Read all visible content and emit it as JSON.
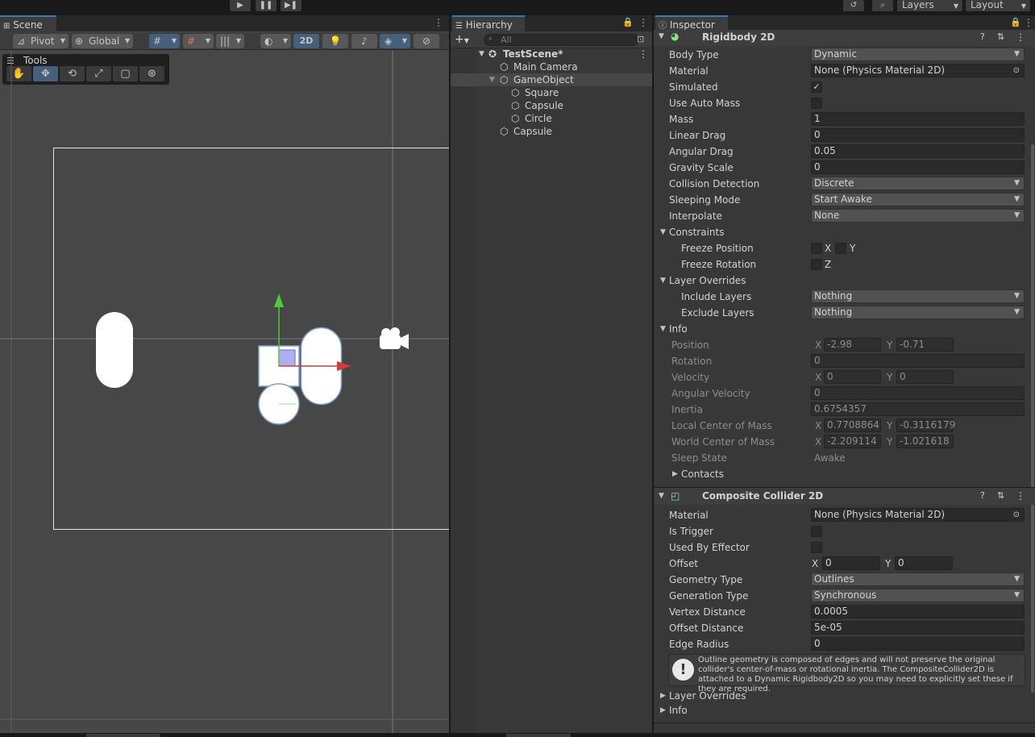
{
  "toolbar": {
    "play_icon": "play-icon",
    "pause_icon": "pause-icon",
    "step_icon": "step-icon",
    "history_icon": "history-icon",
    "search_icon": "search-icon",
    "layers_label": "Layers",
    "layout_label": "Layout"
  },
  "scene": {
    "tab_label": "Scene",
    "pivot_label": "Pivot",
    "global_label": "Global",
    "mode_2d_label": "2D",
    "tools_label": "Tools",
    "tools": [
      "hand-icon",
      "move-icon",
      "rotate-icon",
      "scale-icon",
      "rect-icon",
      "transform-icon"
    ]
  },
  "hierarchy": {
    "tab_label": "Hierarchy",
    "search_placeholder": "All",
    "items": [
      {
        "label": "TestScene*",
        "icon": "unity-scene-icon"
      },
      {
        "label": "Main Camera",
        "icon": "cube-icon"
      },
      {
        "label": "GameObject",
        "icon": "cube-icon",
        "selected": true
      },
      {
        "label": "Square",
        "icon": "cube-icon"
      },
      {
        "label": "Capsule",
        "icon": "cube-icon"
      },
      {
        "label": "Circle",
        "icon": "cube-icon"
      },
      {
        "label": "Capsule",
        "icon": "cube-icon"
      }
    ]
  },
  "inspector": {
    "tab_label": "Inspector",
    "rigidbody": {
      "title": "Rigidbody 2D",
      "body_type_label": "Body Type",
      "body_type": "Dynamic",
      "material_label": "Material",
      "material": "None (Physics Material 2D)",
      "simulated_label": "Simulated",
      "simulated_check": "✓",
      "use_auto_mass_label": "Use Auto Mass",
      "mass_label": "Mass",
      "mass": "1",
      "linear_drag_label": "Linear Drag",
      "linear_drag": "0",
      "angular_drag_label": "Angular Drag",
      "angular_drag": "0.05",
      "gravity_scale_label": "Gravity Scale",
      "gravity_scale": "0",
      "collision_detection_label": "Collision Detection",
      "collision_detection": "Discrete",
      "sleeping_mode_label": "Sleeping Mode",
      "sleeping_mode": "Start Awake",
      "interpolate_label": "Interpolate",
      "interpolate": "None",
      "constraints_label": "Constraints",
      "freeze_position_label": "Freeze Position",
      "freeze_x": "X",
      "freeze_y": "Y",
      "freeze_rotation_label": "Freeze Rotation",
      "freeze_z": "Z",
      "layer_overrides_label": "Layer Overrides",
      "include_layers_label": "Include Layers",
      "include_layers": "Nothing",
      "exclude_layers_label": "Exclude Layers",
      "exclude_layers": "Nothing",
      "info_label": "Info",
      "position_label": "Position",
      "x_label": "X",
      "y_label": "Y",
      "position_x": "-2.98",
      "position_y": "-0.71",
      "rotation_label": "Rotation",
      "rotation": "0",
      "velocity_label": "Velocity",
      "velocity_x": "0",
      "velocity_y": "0",
      "angular_velocity_label": "Angular Velocity",
      "angular_velocity": "0",
      "inertia_label": "Inertia",
      "inertia": "0.6754357",
      "local_com_label": "Local Center of Mass",
      "local_com_x": "0.7708864",
      "local_com_y": "-0.3116179",
      "world_com_label": "World Center of Mass",
      "world_com_x": "-2.209114",
      "world_com_y": "-1.021618",
      "sleep_state_label": "Sleep State",
      "sleep_state": "Awake",
      "contacts_label": "Contacts"
    },
    "composite": {
      "title": "Composite Collider 2D",
      "material_label": "Material",
      "material": "None (Physics Material 2D)",
      "is_trigger_label": "Is Trigger",
      "used_by_effector_label": "Used By Effector",
      "offset_label": "Offset",
      "x_label": "X",
      "y_label": "Y",
      "offset_x": "0",
      "offset_y": "0",
      "geometry_type_label": "Geometry Type",
      "geometry_type": "Outlines",
      "generation_type_label": "Generation Type",
      "generation_type": "Synchronous",
      "vertex_distance_label": "Vertex Distance",
      "vertex_distance": "0.0005",
      "offset_distance_label": "Offset Distance",
      "offset_distance": "5e-05",
      "edge_radius_label": "Edge Radius",
      "edge_radius": "0",
      "warning": "Outline geometry is composed of edges and will not preserve the original collider's center-of-mass or rotational inertia.  The CompositeCollider2D is attached to a Dynamic Rigidbody2D so you may need to explicitly set these if they are required.",
      "layer_overrides_label": "Layer Overrides",
      "info_label": "Info"
    }
  }
}
